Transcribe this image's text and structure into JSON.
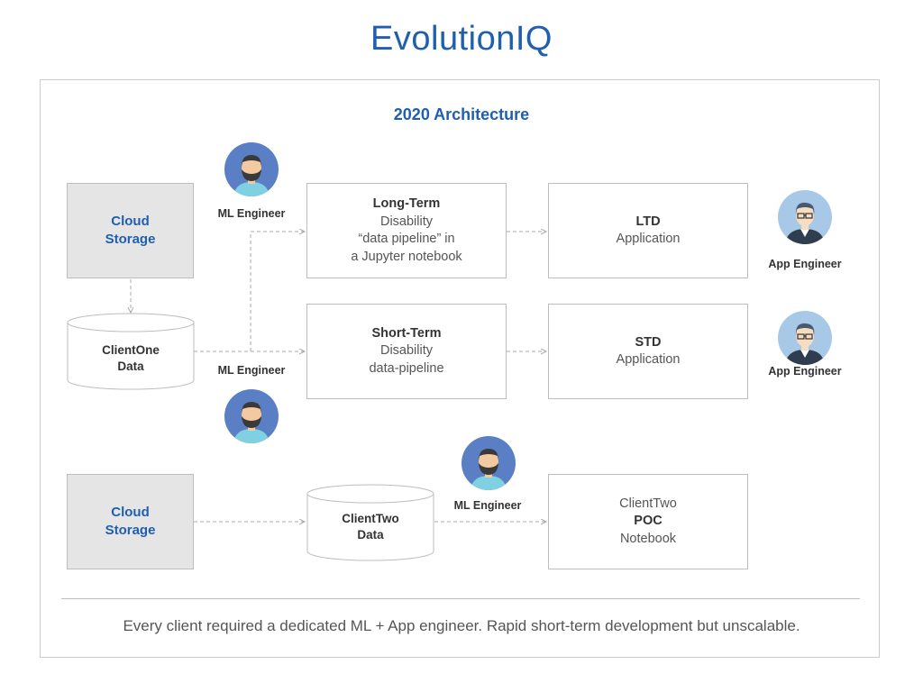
{
  "logo": {
    "prefix": "E",
    "mark": "v",
    "suffix": "olutionIQ"
  },
  "title": "2020 Architecture",
  "storage_top": {
    "line1": "Cloud",
    "line2": "Storage"
  },
  "storage_bottom": {
    "line1": "Cloud",
    "line2": "Storage"
  },
  "client_one": {
    "line1": "ClientOne",
    "line2": "Data"
  },
  "client_two": {
    "line1": "ClientTwo",
    "line2": "Data"
  },
  "ltd_pipeline": {
    "line1": "Long-Term",
    "line2": "Disability",
    "line3": "“data pipeline” in",
    "line4": "a Jupyter notebook"
  },
  "std_pipeline": {
    "line1": "Short-Term",
    "line2": "Disability",
    "line3": "data-pipeline"
  },
  "ltd_app": {
    "line1": "LTD",
    "line2": "Application"
  },
  "std_app": {
    "line1": "STD",
    "line2": "Application"
  },
  "poc": {
    "line1": "ClientTwo",
    "line2": "POC",
    "line3": "Notebook"
  },
  "people": {
    "ml1": "ML Engineer",
    "ml2": "ML Engineer",
    "ml3": "ML Engineer",
    "app1": "App Engineer",
    "app2": "App Engineer"
  },
  "caption": "Every client required a dedicated ML + App engineer. Rapid short-term development but unscalable.",
  "colors": {
    "brand": "#1f5fb0",
    "avatar_ml": "#5b7fc4",
    "avatar_app": "#a8c8e8",
    "beard": "#3a3a3a"
  },
  "icons": [
    "ml-engineer-avatar-icon",
    "app-engineer-avatar-icon",
    "database-cylinder-icon",
    "arrow-icon"
  ]
}
